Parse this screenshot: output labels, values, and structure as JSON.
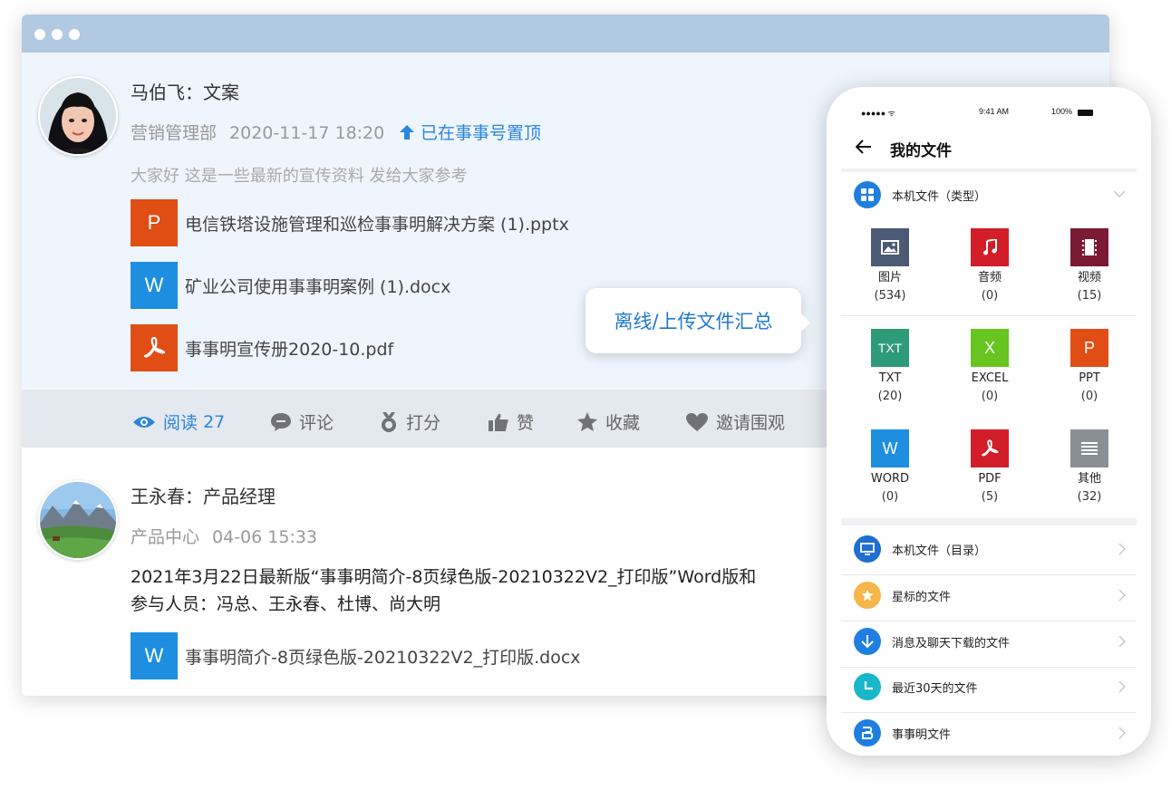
{
  "window": {
    "post1": {
      "author": "马伯飞：文案",
      "department": "营销管理部",
      "datetime": "2020-11-17 18:20",
      "pinned": "已在事事号置顶",
      "description": "大家好 这是一些最新的宣传资料 发给大家参考",
      "files": [
        {
          "icon": "P",
          "name": "电信铁塔设施管理和巡检事事明解决方案 (1).pptx",
          "color": "#e04e16"
        },
        {
          "icon": "W",
          "name": "矿业公司使用事事明案例 (1).docx",
          "color": "#1e8ee0"
        },
        {
          "icon": "pdf",
          "name": "事事明宣传册2020-10.pdf",
          "color": "#e04e16"
        }
      ],
      "actions": {
        "read_label": "阅读",
        "read_count": "27",
        "comment": "评论",
        "rate": "打分",
        "like": "赞",
        "favorite": "收藏",
        "invite": "邀请围观"
      }
    },
    "post2": {
      "author": "王永春：产品经理",
      "department": "产品中心",
      "datetime": "04-06 15:33",
      "line1": "2021年3月22日最新版“事事明简介-8页绿色版-20210322V2_打印版”Word版和",
      "line2": "参与人员：冯总、王永春、杜博、尚大明",
      "files": [
        {
          "icon": "W",
          "name": "事事明简介-8页绿色版-20210322V2_打印版.docx",
          "color": "#1e8ee0"
        }
      ]
    }
  },
  "tooltip": "离线/上传文件汇总",
  "phone": {
    "status": {
      "signal": "●●●●● ᯤ",
      "time": "9:41 AM",
      "battery": "100%"
    },
    "title": "我的文件",
    "category_header": "本机文件（类型）",
    "tiles": [
      {
        "label": "图片",
        "count": "(534)",
        "color": "#4b5a75",
        "icon": "image-icon",
        "text": ""
      },
      {
        "label": "音频",
        "count": "(0)",
        "color": "#d11e28",
        "icon": "music-icon",
        "text": ""
      },
      {
        "label": "视频",
        "count": "(15)",
        "color": "#7a1a33",
        "icon": "video-icon",
        "text": ""
      },
      {
        "label": "TXT",
        "count": "(20)",
        "color": "#2e9b78",
        "icon": "txt-icon",
        "text": "TXT"
      },
      {
        "label": "EXCEL",
        "count": "(0)",
        "color": "#66c51f",
        "icon": "excel-icon",
        "text": "X"
      },
      {
        "label": "PPT",
        "count": "(0)",
        "color": "#e04e16",
        "icon": "ppt-icon",
        "text": "P"
      },
      {
        "label": "WORD",
        "count": "(0)",
        "color": "#1e8ee0",
        "icon": "word-icon",
        "text": "W"
      },
      {
        "label": "PDF",
        "count": "(5)",
        "color": "#d11e28",
        "icon": "pdf-icon",
        "text": ""
      },
      {
        "label": "其他",
        "count": "(32)",
        "color": "#8a8f96",
        "icon": "other-icon",
        "text": ""
      }
    ],
    "rows": [
      {
        "label": "本机文件（目录）",
        "color": "#1f6fd1"
      },
      {
        "label": "星标的文件",
        "color": "#f6b64a"
      },
      {
        "label": "消息及聊天下载的文件",
        "color": "#1f7fe0"
      },
      {
        "label": "最近30天的文件",
        "color": "#17b7c9"
      },
      {
        "label": "事事明文件",
        "color": "#1f7fe0"
      }
    ]
  }
}
